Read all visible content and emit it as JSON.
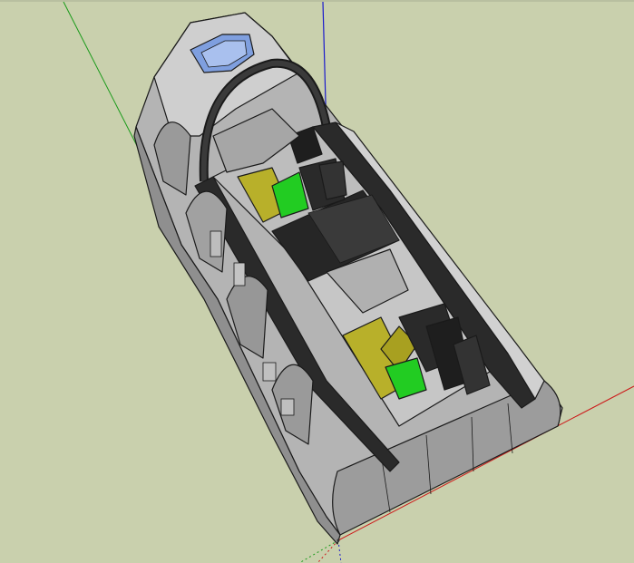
{
  "scene": {
    "background_color": "#c9d0ad",
    "axis_colors": {
      "green_axis": "#1a9a1a",
      "blue_axis": "#1a1acc",
      "red_axis": "#cc1a1a"
    },
    "model_colors": {
      "hull_light": "#c8c8c8",
      "hull_mid": "#a9a9a9",
      "hull_dark": "#8a8a8a",
      "frame_black": "#2a2a2a",
      "seat_yellow": "#b8b02a",
      "seat_green": "#22cc22",
      "window_blue": "#7f9fdf"
    },
    "icons": [
      "axis-origin-icon"
    ]
  }
}
